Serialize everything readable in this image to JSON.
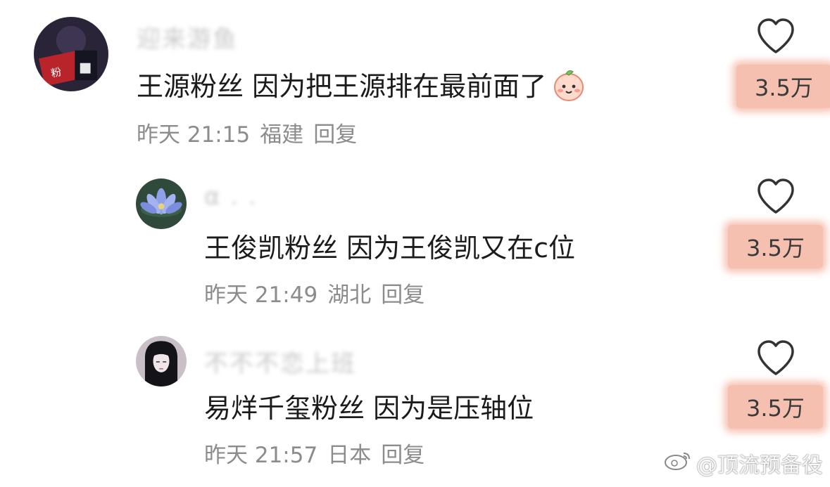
{
  "comments": [
    {
      "username": "迎来游鱼",
      "content": "王源粉丝 因为把王源排在最前面了",
      "time": "昨天 21:15",
      "location": "福建",
      "reply_label": "回复",
      "likes": "3.5万",
      "emoji_icon": "smiling-peach-emoji"
    },
    {
      "username": "α . .",
      "content": "王俊凯粉丝 因为王俊凯又在c位",
      "time": "昨天 21:49",
      "location": "湖北",
      "reply_label": "回复",
      "likes": "3.5万"
    },
    {
      "username": "不不不恋上班",
      "content": "易烊千玺粉丝 因为是压轴位",
      "time": "昨天 21:57",
      "location": "日本",
      "reply_label": "回复",
      "likes": "3.5万"
    }
  ],
  "watermark": "@顶流预备役",
  "colors": {
    "highlight": "#f6c0b0",
    "meta_text": "#8c8c8c",
    "heart_outline": "#333333"
  },
  "icons": [
    "heart-icon",
    "weibo-logo-icon"
  ]
}
